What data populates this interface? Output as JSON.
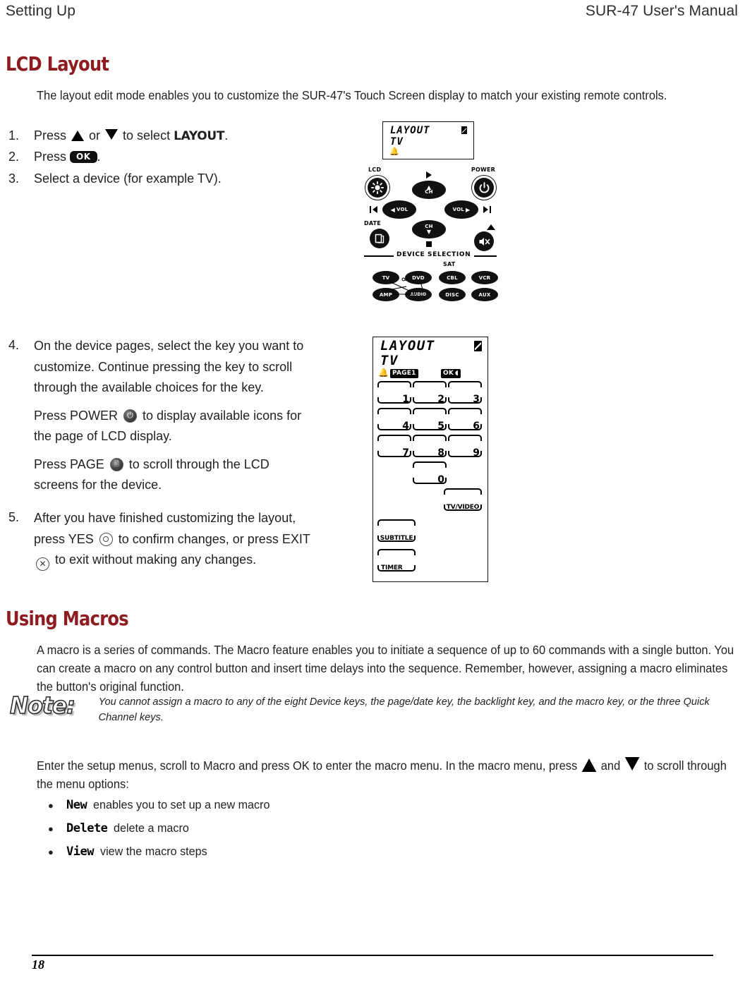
{
  "header": {
    "left": "Setting Up",
    "right": "SUR-47 User's Manual"
  },
  "sections": {
    "lcd_layout": {
      "heading": "LCD Layout",
      "intro": "The layout edit mode enables you to customize the SUR-47's Touch Screen display to match your existing remote controls.",
      "steps": [
        {
          "num": "1.",
          "pre": "Press ",
          "mid": " or ",
          "post": " to select ",
          "label": "LAYOUT",
          "end": "."
        },
        {
          "num": "2.",
          "pre": "Press ",
          "key": "OK",
          "end": "."
        },
        {
          "num": "3.",
          "text": "Select a device (for example TV)."
        },
        {
          "num": "4.",
          "para1": "On the device pages, select the key you want to customize. Continue pressing the key to scroll through the available choices for the key.",
          "para2_pre": "Press POWER ",
          "para2_post": " to display available icons for the page of LCD display.",
          "para3_pre": "Press PAGE ",
          "para3_post": " to scroll through the LCD screens for the device."
        },
        {
          "num": "5.",
          "pre": "After you have finished customizing the layout, press YES ",
          "mid": " to confirm changes, or press EXIT ",
          "post": " to exit without making any changes."
        }
      ]
    },
    "using_macros": {
      "heading": "Using Macros",
      "intro": "A macro is a series of commands. The Macro feature enables you to initiate a sequence of up to 60 commands with a single button. You can create a macro on any control button and insert time delays into the sequence. Remember, however, assigning a macro eliminates the button's original function.",
      "note": {
        "label": "Note:",
        "text": "You cannot assign a macro to any of the eight Device keys, the page/date key, the backlight key, and the macro key, or the three Quick Channel keys."
      },
      "menu_intro_pre": "Enter the setup menus, scroll to Macro and press OK to enter the macro menu. In the macro menu, press ",
      "menu_intro_mid": " and ",
      "menu_intro_post": " to scroll through the menu options:",
      "options": [
        {
          "name": "New",
          "desc": "enables you to set up a new macro"
        },
        {
          "name": "Delete",
          "desc": "delete a macro"
        },
        {
          "name": "View",
          "desc": "view the macro steps"
        }
      ]
    }
  },
  "figures": {
    "lcd_small": {
      "title": "LAYOUT",
      "subtitle": "TV",
      "battery_icon": "battery-icon",
      "bell_icon": "bell-icon"
    },
    "remote": {
      "labels": {
        "lcd": "LCD",
        "power": "POWER",
        "date": "DATE",
        "sat": "SAT",
        "device_selection": "DEVICE SELECTION"
      },
      "keys": {
        "ch_up": "CH",
        "ch_down": "CH",
        "vol_down": "VOL",
        "vol_up": "VOL"
      },
      "devices": [
        "TV",
        "DVD",
        "CBL",
        "VCR",
        "AMP",
        "AUDIO",
        "DISC",
        "AUX"
      ]
    },
    "lcd_layout_panel": {
      "title": "LAYOUT",
      "subtitle": "TV",
      "page_tag": "PAGE1",
      "ok_tag": "OK",
      "battery_icon": "battery-icon",
      "bell_icon": "bell-icon",
      "number_keys": [
        "1",
        "2",
        "3",
        "4",
        "5",
        "6",
        "7",
        "8",
        "9",
        "0"
      ],
      "function_keys": [
        "TV/VIDEO",
        "SUBTITLE",
        "TIMER"
      ]
    }
  },
  "footer": {
    "page_number": "18"
  },
  "colors": {
    "heading": "#8e1b20",
    "body_text": "#231f20",
    "rule": "#000000"
  }
}
